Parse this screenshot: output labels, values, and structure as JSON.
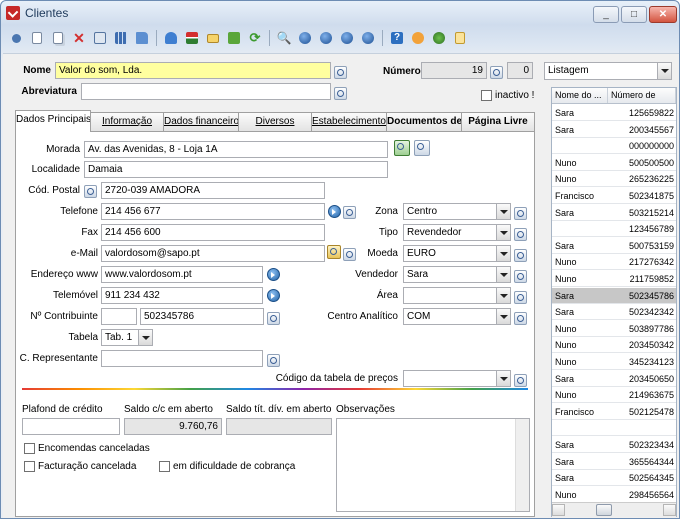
{
  "window": {
    "title": "Clientes"
  },
  "toolbar": {
    "icons": [
      "nav-dot-icon",
      "new-doc-icon",
      "copy-doc-icon",
      "delete-icon",
      "edit-icon",
      "grid-icon",
      "open-folder-icon",
      "books-icon",
      "tree-icon",
      "mail-icon",
      "folder-green-icon",
      "refresh-icon",
      "preview-icon",
      "nav-first-icon",
      "nav-prev-icon",
      "nav-next-icon",
      "nav-last-icon",
      "help-icon",
      "tools-icon",
      "globe-icon",
      "export-icon"
    ]
  },
  "header": {
    "name_label": "Nome",
    "name_value": "Valor do som, Lda.",
    "abbr_label": "Abreviatura",
    "abbr_value": "",
    "number_label": "Número",
    "number_value": "19",
    "number_suffix": "0",
    "inactive_label": "inactivo !"
  },
  "tabs": [
    "Dados Principais",
    "Informação",
    "Dados financeiro",
    "Diversos",
    "Estabelecimentos",
    "Documentos de",
    "Página Livre"
  ],
  "form": {
    "morada_label": "Morada",
    "morada_value": "Av. das Avenidas, 8 - Loja 1A",
    "localidade_label": "Localidade",
    "localidade_value": "Damaia",
    "cp_label": "Cód. Postal",
    "cp_value": "2720-039 AMADORA",
    "telefone_label": "Telefone",
    "telefone_value": "214 456 677",
    "fax_label": "Fax",
    "fax_value": "214 456 600",
    "email_label": "e-Mail",
    "email_value": "valordosom@sapo.pt",
    "www_label": "Endereço www",
    "www_value": "www.valordosom.pt",
    "telemovel_label": "Telemóvel",
    "telemovel_value": "911 234 432",
    "contribuinte_label": "Nº Contribuinte",
    "contribuinte_prefix": "",
    "contribuinte_value": "502345786",
    "tabela_label": "Tabela",
    "tabela_value": "Tab. 1",
    "representante_label": "C. Representante",
    "representante_value": "",
    "zona_label": "Zona",
    "zona_value": "Centro",
    "tipo_label": "Tipo",
    "tipo_value": "Revendedor",
    "moeda_label": "Moeda",
    "moeda_value": "EURO",
    "vendedor_label": "Vendedor",
    "vendedor_value": "Sara",
    "area_label": "Área",
    "area_value": "",
    "centro_label": "Centro Analítico",
    "centro_value": "COM",
    "codigo_tabela_label": "Código da tabela de preços",
    "codigo_tabela_value": ""
  },
  "financial": {
    "plafond_label": "Plafond de crédito",
    "plafond_value": "",
    "saldo_label": "Saldo c/c em aberto",
    "saldo_value": "9.760,76",
    "saldo_tit_label": "Saldo tít. dív. em aberto",
    "saldo_tit_value": "",
    "obs_label": "Observações",
    "obs_value": "",
    "encomendas_label": "Encomendas canceladas",
    "facturacao_label": "Facturação cancelada",
    "dificuldade_label": "em dificuldade de cobrança"
  },
  "list": {
    "view_value": "Listagem",
    "col_name": "Nome do ...",
    "col_number": "Número de",
    "rows": [
      {
        "name": "Sara",
        "number": "125659822"
      },
      {
        "name": "Sara",
        "number": "200345567"
      },
      {
        "name": "",
        "number": "000000000"
      },
      {
        "name": "Nuno",
        "number": "500500500"
      },
      {
        "name": "Nuno",
        "number": "265236225"
      },
      {
        "name": "Francisco",
        "number": "502341875"
      },
      {
        "name": "Sara",
        "number": "503215214"
      },
      {
        "name": "",
        "number": "123456789"
      },
      {
        "name": "Sara",
        "number": "500753159"
      },
      {
        "name": "Nuno",
        "number": "217276342"
      },
      {
        "name": "Nuno",
        "number": "211759852"
      },
      {
        "name": "Sara",
        "number": "502345786"
      },
      {
        "name": "Sara",
        "number": "502342342"
      },
      {
        "name": "Nuno",
        "number": "503897786"
      },
      {
        "name": "Nuno",
        "number": "203450342"
      },
      {
        "name": "Nuno",
        "number": "345234123"
      },
      {
        "name": "Sara",
        "number": "203450650"
      },
      {
        "name": "Nuno",
        "number": "214963675"
      },
      {
        "name": "Francisco",
        "number": "502125478"
      },
      {
        "name": "",
        "number": ""
      },
      {
        "name": "Sara",
        "number": "502323434"
      },
      {
        "name": "Sara",
        "number": "365564344"
      },
      {
        "name": "Sara",
        "number": "502564345"
      },
      {
        "name": "Nuno",
        "number": "298456564"
      }
    ]
  }
}
